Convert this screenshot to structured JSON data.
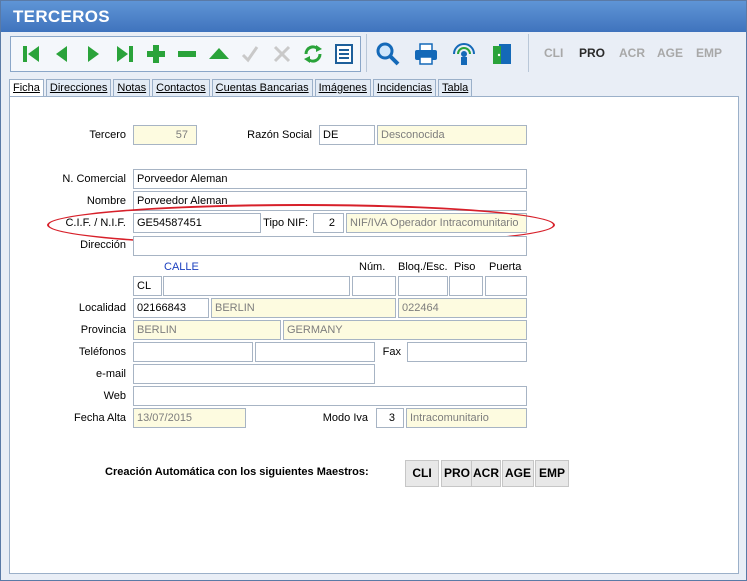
{
  "window": {
    "title": "TERCEROS"
  },
  "toolbar": {
    "nav_icons": [
      "first-record-icon",
      "previous-record-icon",
      "next-record-icon",
      "last-record-icon",
      "add-icon",
      "remove-icon",
      "up-icon",
      "check-icon",
      "cancel-icon",
      "refresh-icon",
      "list-icon"
    ],
    "tool_icons": [
      "search-icon",
      "print-icon",
      "wireless-icon",
      "exit-door-icon"
    ],
    "modules": [
      {
        "label": "CLI",
        "active": false
      },
      {
        "label": "PRO",
        "active": true
      },
      {
        "label": "ACR",
        "active": false
      },
      {
        "label": "AGE",
        "active": false
      },
      {
        "label": "EMP",
        "active": false
      }
    ]
  },
  "tabs": [
    "Ficha",
    "Direcciones",
    "Notas",
    "Contactos",
    "Cuentas Bancarias",
    "Imágenes",
    "Incidencias",
    "Tabla"
  ],
  "form": {
    "tercero_label": "Tercero",
    "tercero_value": "57",
    "razon_social_label": "Razón Social",
    "razon_social_code": "DE",
    "razon_social_desc": "Desconocida",
    "n_comercial_label": "N. Comercial",
    "n_comercial_value": "Porveedor Aleman",
    "nombre_label": "Nombre",
    "nombre_value": "Porveedor Aleman",
    "cif_label": "C.I.F. / N.I.F.",
    "cif_value": "GE54587451",
    "tipo_nif_label": "Tipo NIF:",
    "tipo_nif_value": "2",
    "tipo_nif_desc": "NIF/IVA Operador Intracomunitario",
    "direccion_label": "Dirección",
    "calle_header": "CALLE",
    "num_header": "Núm.",
    "bloq_header": "Bloq./Esc.",
    "piso_header": "Piso",
    "puerta_header": "Puerta",
    "via_value": "CL",
    "localidad_label": "Localidad",
    "localidad_code": "02166843",
    "localidad_name": "BERLIN",
    "localidad_cp": "022464",
    "provincia_label": "Provincia",
    "provincia_value": "BERLIN",
    "pais_value": "GERMANY",
    "telefonos_label": "Teléfonos",
    "fax_label": "Fax",
    "email_label": "e-mail",
    "web_label": "Web",
    "fecha_alta_label": "Fecha Alta",
    "fecha_alta_value": "13/07/2015",
    "modo_iva_label": "Modo Iva",
    "modo_iva_value": "3",
    "modo_iva_desc": "Intracomunitario"
  },
  "auto_create": {
    "label": "Creación Automática con los siguientes Maestros:",
    "buttons": [
      "CLI",
      "PRO",
      "ACR",
      "AGE",
      "EMP"
    ]
  },
  "colors": {
    "title_bar": "#4a7fc8",
    "nav_green": "#2aa33a",
    "highlight_red": "#d7202a"
  }
}
